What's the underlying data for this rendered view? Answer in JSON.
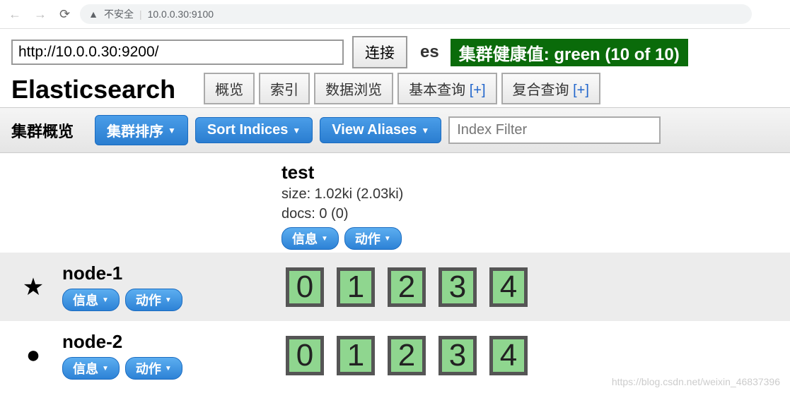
{
  "browser": {
    "insecure_label": "不安全",
    "address": "10.0.0.30:9100"
  },
  "connect": {
    "url": "http://10.0.0.30:9200/",
    "button": "连接",
    "cluster_name": "es",
    "health_text": "集群健康值: green (10 of 10)"
  },
  "app_title": "Elasticsearch",
  "tabs": {
    "overview": "概览",
    "indices": "索引",
    "browse": "数据浏览",
    "basic_query": "基本查询 ",
    "compound_query": "复合查询 ",
    "plus": "[+]"
  },
  "toolbar": {
    "title": "集群概览",
    "sort_cluster": "集群排序",
    "sort_indices": "Sort Indices",
    "view_aliases": "View Aliases",
    "filter_placeholder": "Index Filter"
  },
  "index": {
    "name": "test",
    "size": "size: 1.02ki (2.03ki)",
    "docs": "docs: 0 (0)",
    "info_btn": "信息",
    "action_btn": "动作"
  },
  "nodes": [
    {
      "name": "node-1",
      "master": true,
      "shards": [
        "0",
        "1",
        "2",
        "3",
        "4"
      ]
    },
    {
      "name": "node-2",
      "master": false,
      "shards": [
        "0",
        "1",
        "2",
        "3",
        "4"
      ]
    }
  ],
  "node_buttons": {
    "info": "信息",
    "action": "动作"
  },
  "watermark": "https://blog.csdn.net/weixin_46837396"
}
